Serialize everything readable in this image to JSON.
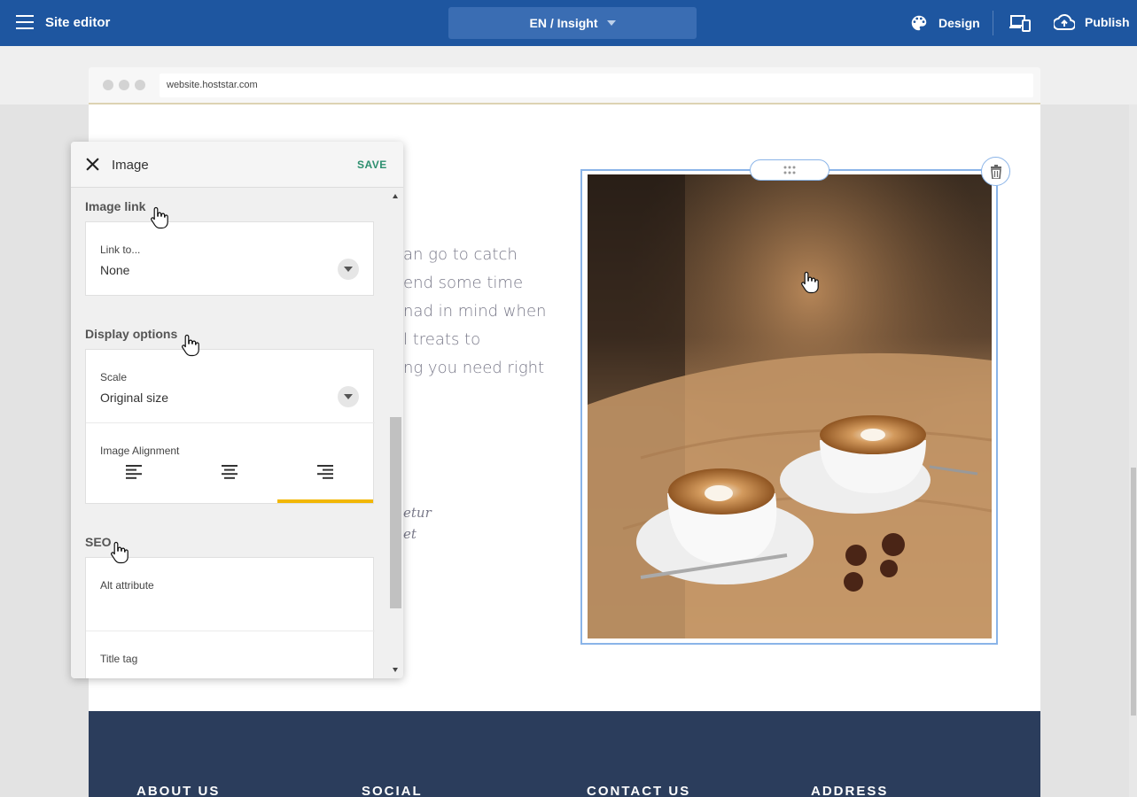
{
  "topbar": {
    "menu_icon": "hamburger-icon",
    "title": "Site editor",
    "language_page": "EN / Insight",
    "design_label": "Design",
    "publish_label": "Publish"
  },
  "browser": {
    "url": "website.hoststar.com"
  },
  "page_content": {
    "body_lines": [
      "an go to catch",
      "end some time",
      "nad in mind when",
      "l treats to",
      "ng you need right"
    ],
    "italic_lines": [
      "etur",
      "et"
    ]
  },
  "footer": {
    "columns": [
      "ABOUT US",
      "SOCIAL",
      "CONTACT US",
      "ADDRESS"
    ]
  },
  "panel": {
    "title": "Image",
    "save_label": "SAVE",
    "image_link": {
      "heading": "Image link",
      "field_label": "Link to...",
      "field_value": "None"
    },
    "display_options": {
      "heading": "Display options",
      "scale_label": "Scale",
      "scale_value": "Original size",
      "alignment_label": "Image Alignment",
      "alignment_options": [
        "left",
        "center",
        "right"
      ],
      "alignment_selected": "right"
    },
    "seo": {
      "heading": "SEO",
      "alt_label": "Alt attribute",
      "alt_value": "",
      "title_label": "Title tag",
      "title_value": ""
    }
  },
  "colors": {
    "topbar": "#1e56a0",
    "save": "#2d8f6f",
    "selection": "#8ab4e8",
    "active_tab": "#f2b705",
    "footer": "#2b3d5c"
  }
}
